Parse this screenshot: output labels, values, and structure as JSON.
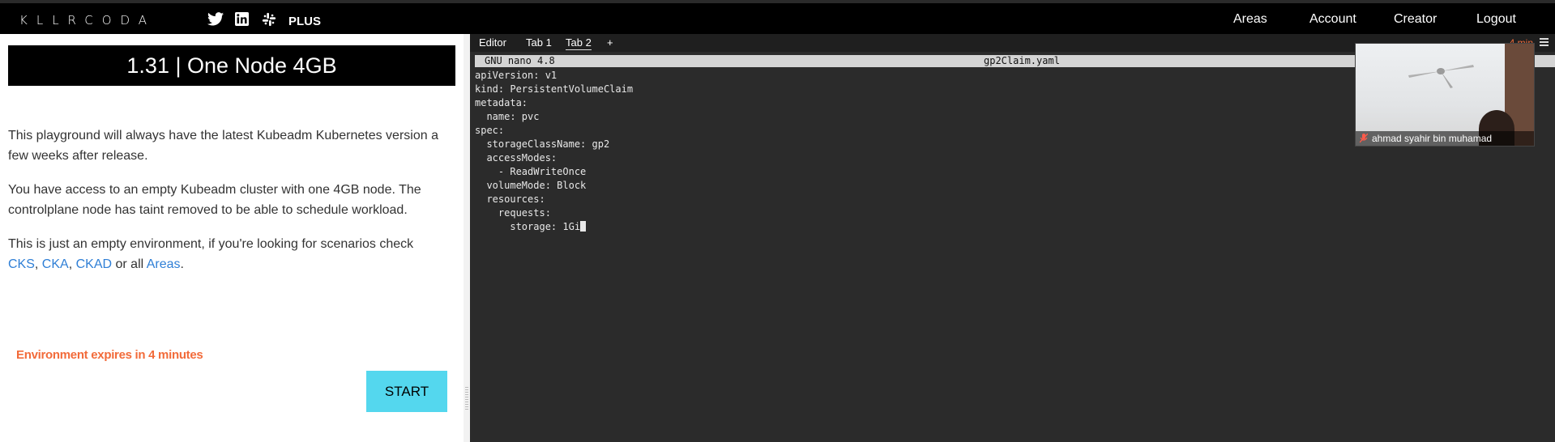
{
  "header": {
    "logo": "KLLRCODA",
    "plus_label": "PLUS",
    "nav": [
      "Areas",
      "Account",
      "Creator",
      "Logout"
    ]
  },
  "scenario": {
    "title": "1.31 | One Node 4GB",
    "para1": "This playground will always have the latest Kubeadm Kubernetes version a few weeks after release.",
    "para2": "You have access to an empty Kubeadm cluster with one 4GB node. The controlplane node has taint removed to be able to schedule workload.",
    "para3_prefix": "This is just an empty environment, if you're looking for scenarios check",
    "links": [
      "CKS",
      "CKA",
      "CKAD",
      "Areas"
    ],
    "sep1": ", ",
    "sep2": " or all ",
    "period": ".",
    "expires": "Environment expires in 4 minutes",
    "start_label": "START"
  },
  "terminal": {
    "tabs": [
      "Editor",
      "Tab 1",
      "Tab 2"
    ],
    "add_tab": "+",
    "timer": "4 min",
    "nano_version": "GNU nano 4.8",
    "filename": "gp2Claim.yaml",
    "lines": [
      "apiVersion: v1",
      "kind: PersistentVolumeClaim",
      "metadata:",
      "  name: pvc",
      "spec:",
      "  storageClassName: gp2",
      "  accessModes:",
      "    - ReadWriteOnce",
      "  volumeMode: Block",
      "  resources:",
      "    requests:",
      "      storage: 1Gi"
    ]
  },
  "video": {
    "participant": "ahmad syahir bin muhamad"
  },
  "colors": {
    "accent_link": "#2f7fd6",
    "expires": "#f26b3a",
    "start_button": "#54d7ee",
    "terminal_bg": "#2b2b2b"
  }
}
